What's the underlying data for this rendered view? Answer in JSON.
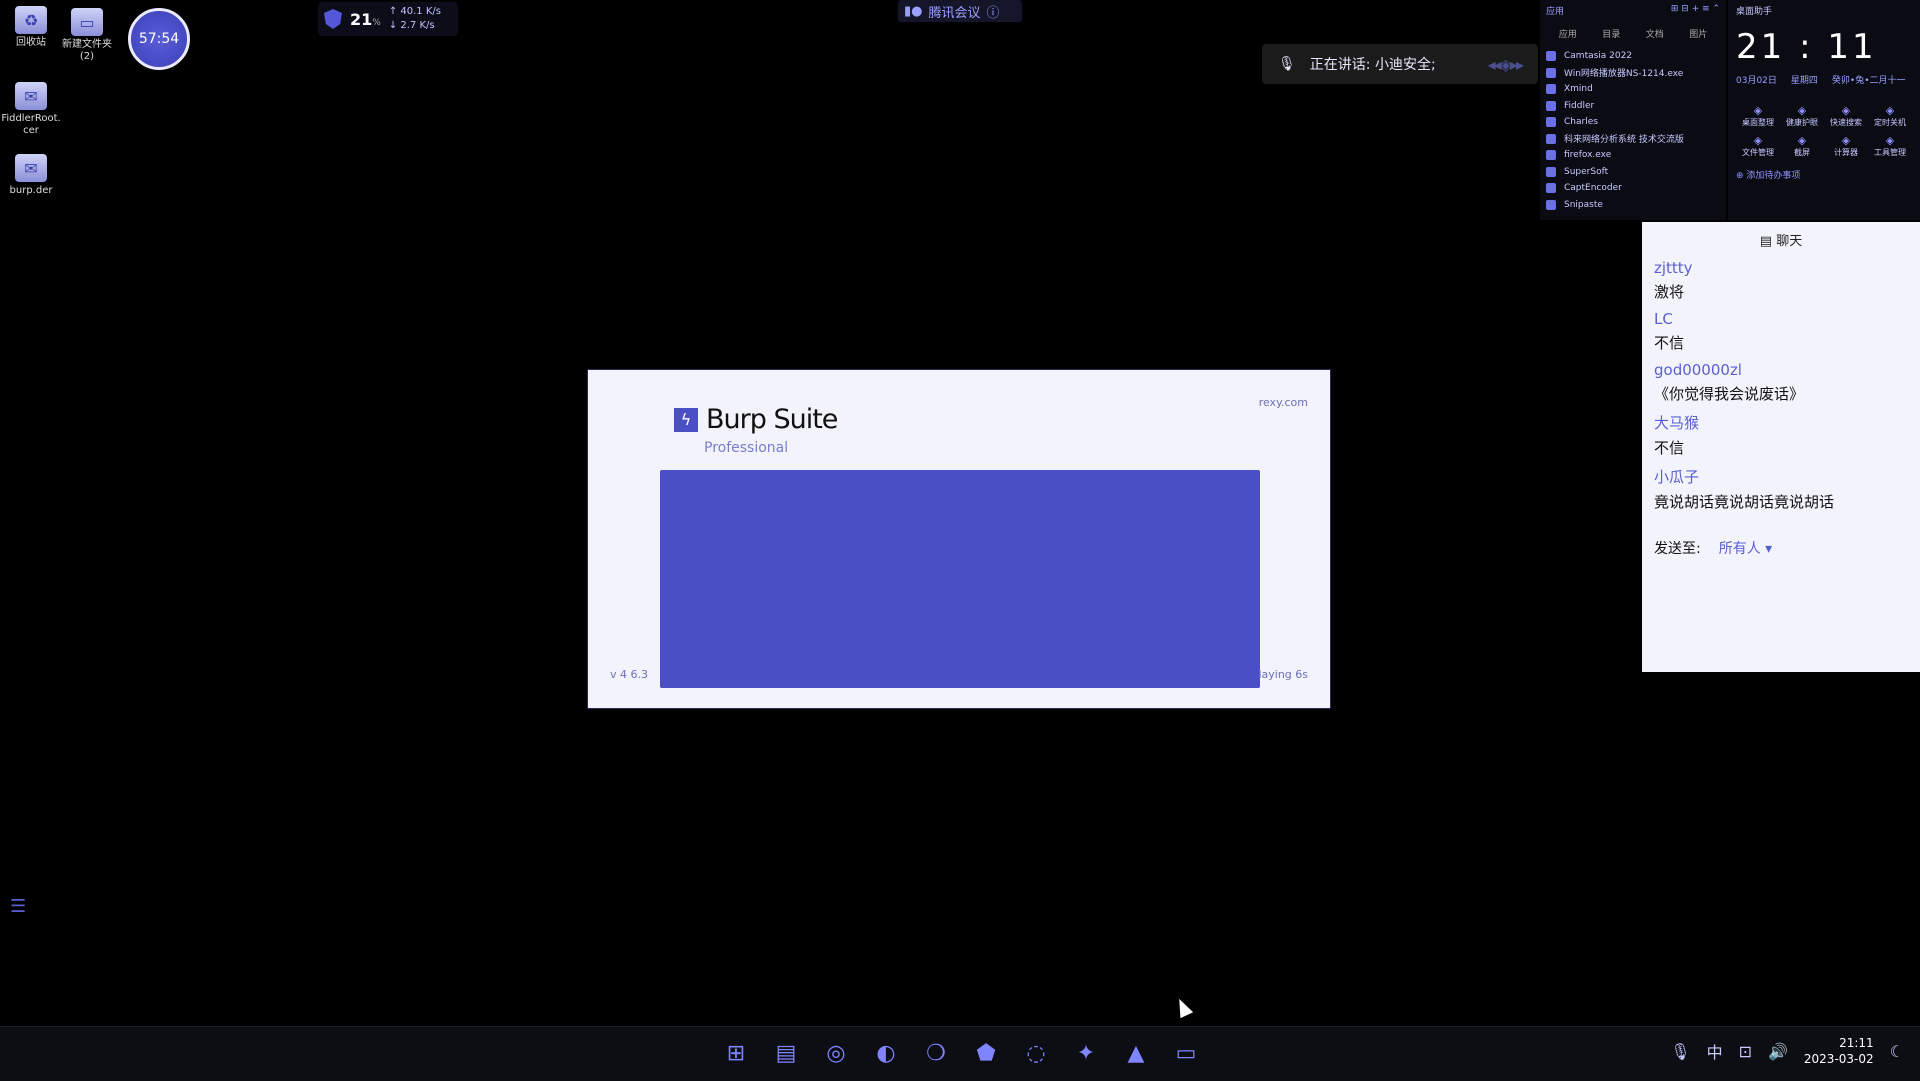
{
  "desktop": {
    "icons": [
      {
        "label": "回收站",
        "icon": "recycle-bin-icon"
      },
      {
        "label": "新建文件夹 (2)",
        "icon": "folder-icon"
      },
      {
        "label": "FiddlerRoot.cer",
        "icon": "certificate-icon"
      },
      {
        "label": "burp.der",
        "icon": "certificate-icon"
      }
    ],
    "timer": "57:54"
  },
  "system_widget": {
    "cpu": "21",
    "cpu_unit": "%",
    "upload": "↑ 40.1 K/s",
    "download": "↓ 2.7 K/s"
  },
  "meeting": {
    "title": "腾讯会议",
    "speaking": "正在讲话: 小迪安全;"
  },
  "app_panel": {
    "header": "应用",
    "tabs": [
      "应用",
      "目录",
      "文档",
      "图片"
    ],
    "items": [
      "Camtasia 2022",
      "Win网络播放器NS-1214.exe",
      "Xmind",
      "Fiddler",
      "Charles",
      "科来网络分析系统 技术交流版",
      "firefox.exe",
      "SuperSoft",
      "CaptEncoder",
      "Snipaste"
    ]
  },
  "clock_panel": {
    "header": "桌面助手",
    "time": "21 : 11",
    "date": "03月02日",
    "weekday": "星期四",
    "lunar": "癸卯•兔•二月十一",
    "tools": [
      "桌面整理",
      "健康护眼",
      "快速搜索",
      "定时关机",
      "文件管理",
      "截屏",
      "计算器",
      "工具管理"
    ],
    "todo": "添加待办事项"
  },
  "chat": {
    "title": "聊天",
    "messages": [
      {
        "name": "zjttty",
        "text": "激将"
      },
      {
        "name": "LC",
        "text": "不信"
      },
      {
        "name": "god00000zl",
        "text": "《你觉得我会说废话》"
      },
      {
        "name": "大马猴",
        "text": "不信"
      },
      {
        "name": "小瓜子",
        "text": "竟说胡话竟说胡话竟说胡话"
      }
    ],
    "send_label": "发送至:",
    "send_to": "所有人 ▾"
  },
  "burp_splash": {
    "name": "Burp Suite",
    "edition": "Professional",
    "url": "rexy.com",
    "version": "v 4 6.3",
    "status": "laying 6s"
  },
  "taskbar": {
    "apps": [
      "start-icon",
      "file-explorer-icon",
      "chrome-icon",
      "edge-icon",
      "wechat-icon",
      "pentagon-app-icon",
      "network-app-icon",
      "terminal-app-icon",
      "meeting-app-icon",
      "console-icon"
    ],
    "ime": "中",
    "time": "21:11",
    "date": "2023-03-02"
  },
  "colors": {
    "accent": "#4b4fc6",
    "panel": "#f3f4fb"
  }
}
